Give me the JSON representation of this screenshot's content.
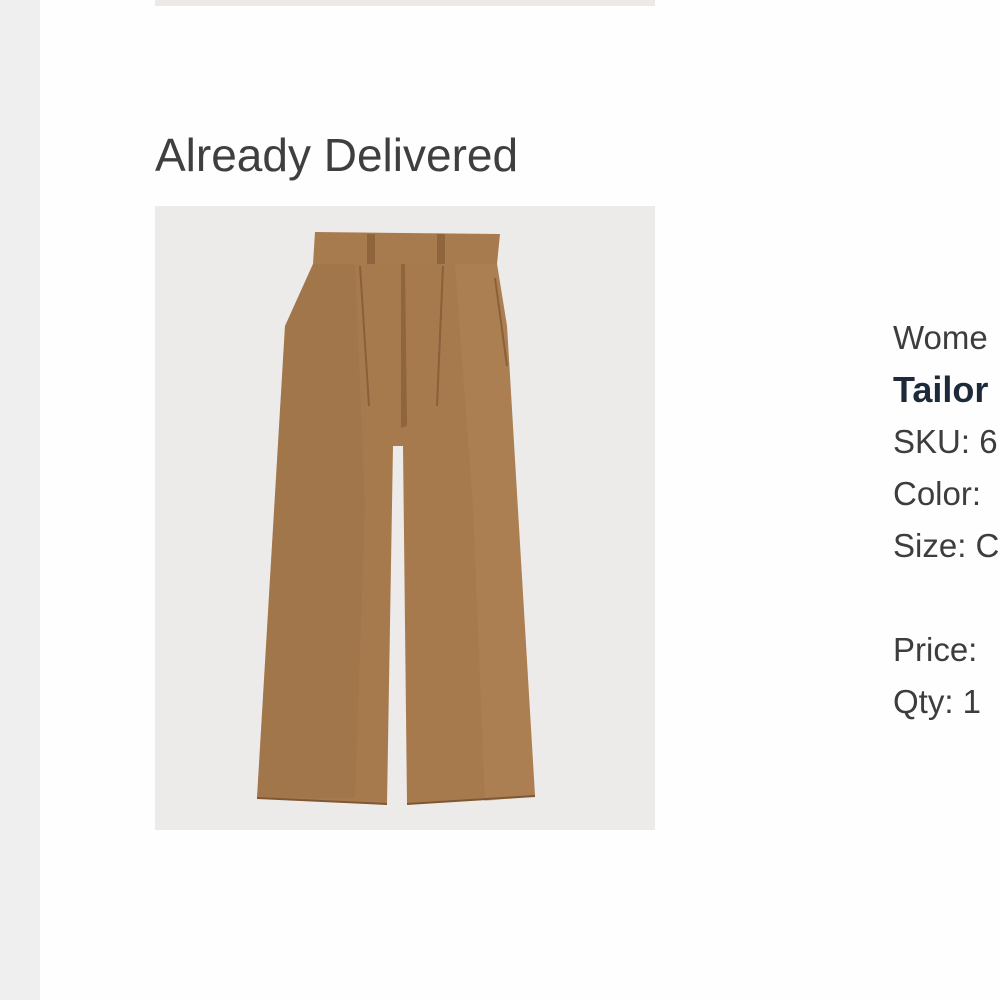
{
  "section": {
    "heading": "Already Delivered"
  },
  "product": {
    "image_alt": "brown wide-leg pleated pants",
    "category": "Wome",
    "name": "Tailor",
    "sku": "SKU: 6",
    "color": "Color:",
    "size": "Size: C",
    "price": "Price:",
    "qty": "Qty: 1"
  },
  "colors": {
    "pants": "#a77a4e",
    "image_bg": "#edebe9",
    "name_text": "#1d2a3a"
  }
}
